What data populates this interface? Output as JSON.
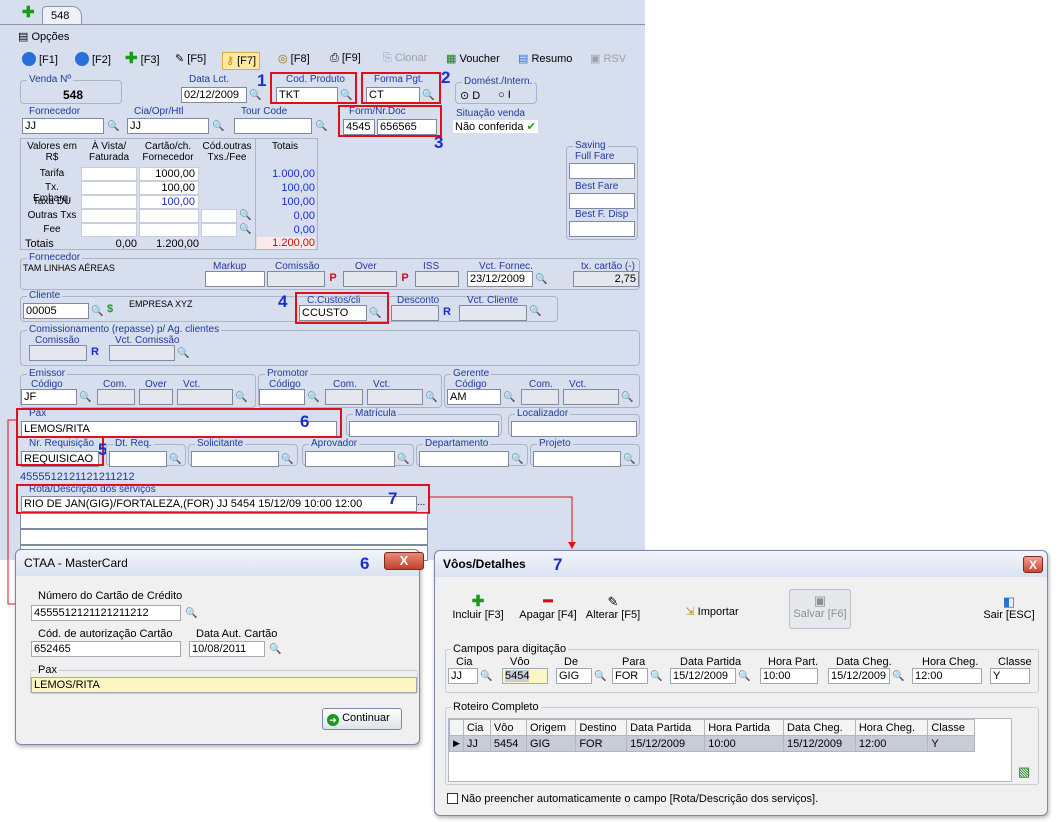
{
  "tab": {
    "label": "548",
    "options": "Opções"
  },
  "toolbar": {
    "f1": "[F1]",
    "f2": "[F2]",
    "f3": "[F3]",
    "f5": "[F5]",
    "f7": "[F7]",
    "f8": "[F8]",
    "f9": "[F9]",
    "clonar": "Clonar",
    "voucher": "Voucher",
    "resumo": "Resumo",
    "rsv": "RSV"
  },
  "venda": {
    "label": "Venda Nº",
    "value": "548"
  },
  "data_lct": {
    "label": "Data Lct.",
    "value": "02/12/2009"
  },
  "cod_produto": {
    "label": "Cod. Produto",
    "value": "TKT"
  },
  "forma_pgt": {
    "label": "Forma Pgt.",
    "value": "CT"
  },
  "domest": {
    "label": "Domést./Intern.",
    "opt_d": "D",
    "opt_i": "I"
  },
  "fornecedor": {
    "label": "Fornecedor",
    "value": "JJ"
  },
  "cia": {
    "label": "Cia/Opr/Htl",
    "value": "JJ"
  },
  "tour": {
    "label": "Tour Code",
    "value": ""
  },
  "form_doc": {
    "label": "Form/Nr.Doc",
    "form": "4545",
    "doc": "656565"
  },
  "situacao": {
    "label": "Situação venda",
    "value": "Não conferida"
  },
  "values_table": {
    "headers": [
      "Valores em R$",
      "À Vista/ Faturada",
      "Cartão/ch. Fornecedor",
      "Cód.outras Txs./Fee",
      "Totais"
    ],
    "rows": [
      {
        "label": "Tarifa",
        "cartao": "1000,00",
        "total": "1.000,00"
      },
      {
        "label": "Tx. Embarq.",
        "cartao": "100,00",
        "total": "100,00"
      },
      {
        "label": "Taxa DU",
        "cartao": "100,00",
        "total": "100,00"
      },
      {
        "label": "Outras Txs",
        "cartao": "",
        "total": "0,00"
      },
      {
        "label": "Fee",
        "cartao": "",
        "total": "0,00"
      }
    ],
    "totals_label": "Totais",
    "totals_vista": "0,00",
    "totals_cartao": "1.200,00",
    "totals_total": "1.200,00"
  },
  "saving": {
    "label": "Saving",
    "full_fare": "Full Fare",
    "best_fare": "Best Fare",
    "best_disp": "Best F. Disp"
  },
  "fornecedor2": {
    "label": "Fornecedor",
    "value": "TAM LINHAS AÉREAS",
    "markup": "Markup",
    "comissao": "Comissão",
    "over": "Over",
    "iss": "ISS",
    "vct_fornec": "Vct. Fornec.",
    "vct_value": "23/12/2009",
    "tx_cartao": "tx. cartão (-)",
    "tx_value": "2,75",
    "p": "P"
  },
  "cliente": {
    "label": "Cliente",
    "value": "00005",
    "name": "EMPRESA XYZ",
    "ccustos_label": "C.Custos/cli",
    "ccustos": "CCUSTO",
    "desconto": "Desconto",
    "vct_cliente": "Vct. Cliente",
    "r": "R"
  },
  "comiss": {
    "label": "Comissionamento (repasse) p/ Ag. clientes",
    "comissao": "Comissão",
    "vct": "Vct. Comissão"
  },
  "emissor": {
    "label": "Emissor",
    "codigo": "Código",
    "value": "JF",
    "com": "Com.",
    "over": "Over",
    "vct": "Vct."
  },
  "promotor": {
    "label": "Promotor",
    "codigo": "Código",
    "com": "Com.",
    "vct": "Vct."
  },
  "gerente": {
    "label": "Gerente",
    "codigo": "Código",
    "value": "AM",
    "com": "Com.",
    "vct": "Vct."
  },
  "pax": {
    "label": "Pax",
    "value": "LEMOS/RITA",
    "matricula": "Matrícula",
    "localizador": "Localizador"
  },
  "req": {
    "label": "Nr. Requisição",
    "value": "REQUISICAO",
    "dt_req": "Dt. Req.",
    "solicitante": "Solicitante",
    "aprovador": "Aprovador",
    "departamento": "Departamento",
    "projeto": "Projeto"
  },
  "card_number_line": "4555512121121211212",
  "rota": {
    "label": "Rota/Descrição dos serviços",
    "value": "RIO DE JAN(GIG)/FORTALEZA,(FOR) JJ 5454 15/12/09 10:00 12:00",
    "dots": "..."
  },
  "annot": [
    "1",
    "2",
    "3",
    "4",
    "5",
    "6",
    "7"
  ],
  "ctaa": {
    "title": "CTAA - MasterCard",
    "num_label": "Número do Cartão de Crédito",
    "num_value": "4555512121121211212",
    "cod_label": "Cód. de autorização Cartão",
    "cod_value": "652465",
    "data_label": "Data Aut. Cartão",
    "data_value": "10/08/2011",
    "pax_label": "Pax",
    "pax_value": "LEMOS/RITA",
    "continuar": "Continuar",
    "close": "X"
  },
  "voos": {
    "title": "Vôos/Detalhes",
    "incluir": "Incluir [F3]",
    "apagar": "Apagar [F4]",
    "alterar": "Alterar [F5]",
    "importar": "Importar",
    "salvar": "Salvar [F6]",
    "sair": "Sair [ESC]",
    "campos_label": "Campos para digitação",
    "fields": {
      "cia": "Cia",
      "cia_v": "JJ",
      "voo": "Vôo",
      "voo_v": "5454",
      "de": "De",
      "de_v": "GIG",
      "para": "Para",
      "para_v": "FOR",
      "dp": "Data Partida",
      "dp_v": "15/12/2009",
      "hp": "Hora Part.",
      "hp_v": "10:00",
      "dc": "Data Cheg.",
      "dc_v": "15/12/2009",
      "hc": "Hora Cheg.",
      "hc_v": "12:00",
      "cl": "Classe",
      "cl_v": "Y"
    },
    "roteiro_label": "Roteiro Completo",
    "columns": [
      "Cia",
      "Vôo",
      "Origem",
      "Destino",
      "Data Partida",
      "Hora Partida",
      "Data Cheg.",
      "Hora Cheg.",
      "Classe"
    ],
    "row": [
      "JJ",
      "5454",
      "GIG",
      "FOR",
      "15/12/2009",
      "10:00",
      "15/12/2009",
      "12:00",
      "Y"
    ],
    "checkbox": "Não preencher automaticamente o campo [Rota/Descrição dos serviços]."
  }
}
